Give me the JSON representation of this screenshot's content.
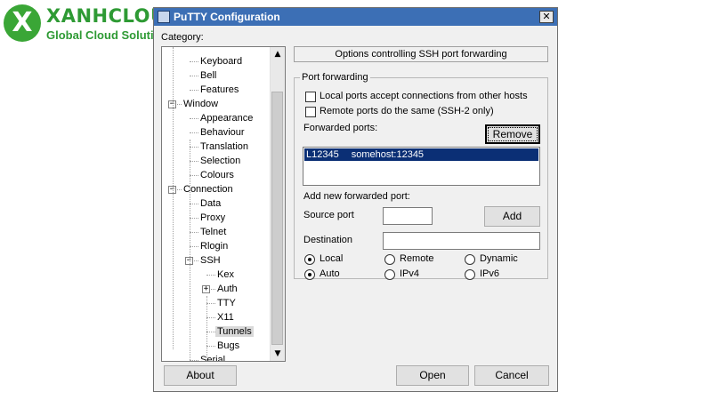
{
  "logo": {
    "mark": "X",
    "title": "XANHCLOUD",
    "subtitle": "Global Cloud Solutions"
  },
  "window": {
    "title": "PuTTY Configuration",
    "close_symbol": "✕"
  },
  "category_label": "Category:",
  "tree": [
    {
      "label": "Keyboard"
    },
    {
      "label": "Bell"
    },
    {
      "label": "Features"
    },
    {
      "label": "Window",
      "expander": "−"
    },
    {
      "label": "Appearance"
    },
    {
      "label": "Behaviour"
    },
    {
      "label": "Translation"
    },
    {
      "label": "Selection"
    },
    {
      "label": "Colours"
    },
    {
      "label": "Connection",
      "expander": "−"
    },
    {
      "label": "Data"
    },
    {
      "label": "Proxy"
    },
    {
      "label": "Telnet"
    },
    {
      "label": "Rlogin"
    },
    {
      "label": "SSH",
      "expander": "−"
    },
    {
      "label": "Kex"
    },
    {
      "label": "Auth",
      "expander": "+"
    },
    {
      "label": "TTY"
    },
    {
      "label": "X11"
    },
    {
      "label": "Tunnels",
      "selected": true
    },
    {
      "label": "Bugs"
    },
    {
      "label": "Serial"
    }
  ],
  "panel": {
    "header": "Options controlling SSH port forwarding",
    "group_label": "Port forwarding",
    "local_accept_label": "Local ports accept connections from other hosts",
    "remote_same_label": "Remote ports do the same (SSH-2 only)",
    "forwarded_label": "Forwarded ports:",
    "remove_label": "Remove",
    "forwarded_entries": [
      {
        "id": "L12345",
        "dest": "somehost:12345"
      }
    ],
    "add_new_label": "Add new forwarded port:",
    "source_port_label": "Source port",
    "source_port_value": "",
    "add_label": "Add",
    "destination_label": "Destination",
    "destination_value": "",
    "radio_local": "Local",
    "radio_remote": "Remote",
    "radio_dynamic": "Dynamic",
    "radio_auto": "Auto",
    "radio_ipv4": "IPv4",
    "radio_ipv6": "IPv6"
  },
  "footer": {
    "about_label": "About",
    "open_label": "Open",
    "cancel_label": "Cancel"
  },
  "scroll": {
    "up_arrow": "▲",
    "down_arrow": "▼"
  },
  "colors": {
    "titlebar": "#3c6fb5",
    "selection": "#0b2f75",
    "logo_green": "#2e9a34"
  }
}
